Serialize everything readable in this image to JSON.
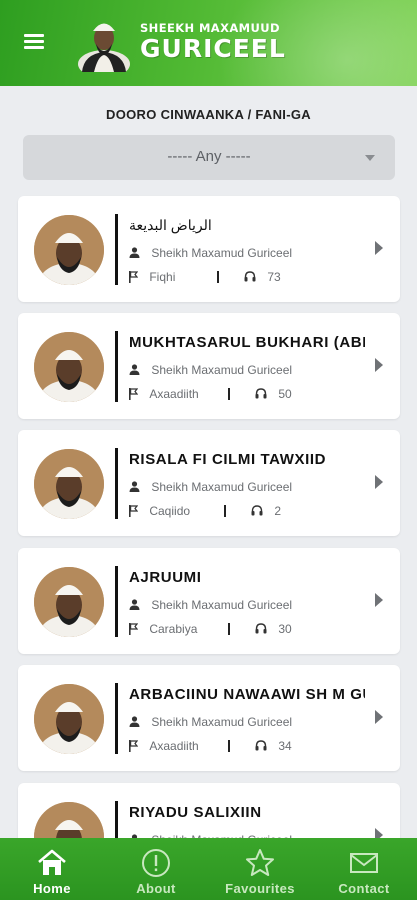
{
  "header": {
    "brand_top": "SHEEKH MAXAMUUD",
    "brand_main": "GURICEEL",
    "menu_icon": "hamburger-menu-icon"
  },
  "category": {
    "label": "DOORO CINWAANKA / FANI-GA",
    "selected": "----- Any -----"
  },
  "books": [
    {
      "title": "الرياض البديعة",
      "author": "Sheikh Maxamud Guriceel",
      "category": "Fiqhi",
      "count": "73",
      "rtl": true
    },
    {
      "title": "MUKHTASARUL BUKHARI (ABI",
      "author": "Sheikh Maxamud Guriceel",
      "category": "Axaadiith",
      "count": "50",
      "rtl": false
    },
    {
      "title": "RISALA FI CILMI TAWXIID",
      "author": "Sheikh Maxamud Guriceel",
      "category": "Caqiido",
      "count": "2",
      "rtl": false
    },
    {
      "title": "AJRUUMI",
      "author": "Sheikh Maxamud Guriceel",
      "category": "Carabiya",
      "count": "30",
      "rtl": false
    },
    {
      "title": "ARBACIINU NAWAAWI SH M GU",
      "author": "Sheikh Maxamud Guriceel",
      "category": "Axaadiith",
      "count": "34",
      "rtl": false
    },
    {
      "title": "RIYADU SALIXIIN",
      "author": "Sheikh Maxamud Guriceel",
      "category": "",
      "count": "",
      "rtl": false
    }
  ],
  "nav": [
    {
      "label": "Home",
      "icon": "home-icon",
      "active": true
    },
    {
      "label": "About",
      "icon": "info-icon",
      "active": false
    },
    {
      "label": "Favourites",
      "icon": "star-icon",
      "active": false
    },
    {
      "label": "Contact",
      "icon": "mail-icon",
      "active": false
    }
  ],
  "colors": {
    "header_green": "#4fb832",
    "nav_green": "#2b9420",
    "background": "#ebedf0"
  }
}
